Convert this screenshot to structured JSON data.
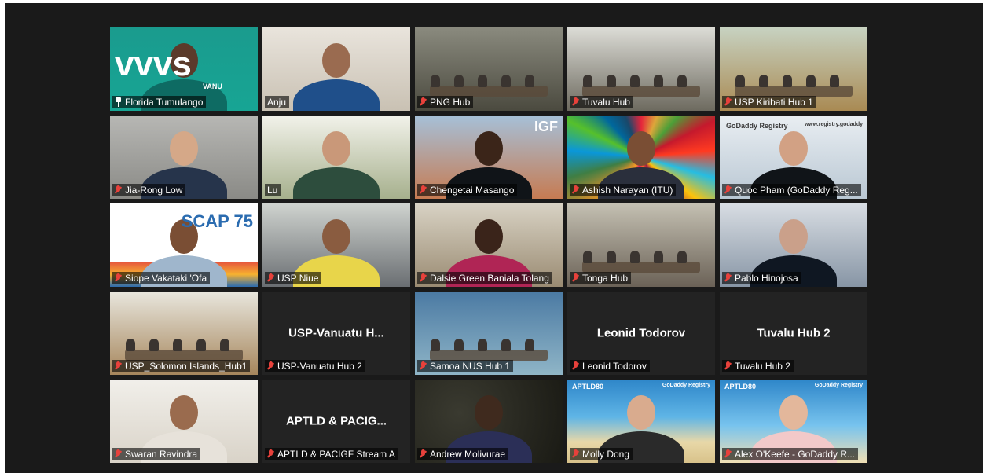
{
  "meeting": {
    "participants": [
      {
        "id": "florida",
        "label": "Florida Tumulango",
        "status": "pinned",
        "display": "video"
      },
      {
        "id": "anju",
        "label": "Anju",
        "status": "none",
        "display": "video"
      },
      {
        "id": "png",
        "label": "PNG Hub",
        "status": "muted",
        "display": "video"
      },
      {
        "id": "tuvalu1",
        "label": "Tuvalu Hub",
        "status": "muted",
        "display": "video"
      },
      {
        "id": "kiribati",
        "label": "USP Kiribati Hub 1",
        "status": "muted",
        "display": "video"
      },
      {
        "id": "jia",
        "label": "Jia-Rong Low",
        "status": "muted",
        "display": "video"
      },
      {
        "id": "lu",
        "label": "Lu",
        "status": "none",
        "display": "video"
      },
      {
        "id": "chengetai",
        "label": "Chengetai Masango",
        "status": "muted",
        "display": "video"
      },
      {
        "id": "ashish",
        "label": "Ashish Narayan (ITU)",
        "status": "muted",
        "display": "video"
      },
      {
        "id": "quoc",
        "label": "Quoc Pham (GoDaddy Reg...",
        "status": "muted",
        "display": "video"
      },
      {
        "id": "siope",
        "label": "Siope Vakataki 'Ofa",
        "status": "muted",
        "display": "video"
      },
      {
        "id": "niue",
        "label": "USP Niue",
        "status": "muted",
        "display": "video"
      },
      {
        "id": "dalsie",
        "label": "Dalsie Green Baniala Tolang",
        "status": "muted",
        "display": "video"
      },
      {
        "id": "tonga",
        "label": "Tonga Hub",
        "status": "muted",
        "display": "video"
      },
      {
        "id": "pablo",
        "label": "Pablo Hinojosa",
        "status": "muted",
        "display": "video"
      },
      {
        "id": "solomon",
        "label": "USP_Solomon Islands_Hub1",
        "status": "muted",
        "display": "video"
      },
      {
        "id": "vanuatu",
        "label": "USP-Vanuatu Hub 2",
        "status": "muted",
        "display": "name",
        "name_display": "USP-Vanuatu  H..."
      },
      {
        "id": "samoa",
        "label": "Samoa NUS Hub 1",
        "status": "muted",
        "display": "video"
      },
      {
        "id": "leonid",
        "label": "Leonid Todorov",
        "status": "muted",
        "display": "name",
        "name_display": "Leonid Todorov"
      },
      {
        "id": "tuvalu2",
        "label": "Tuvalu Hub 2",
        "status": "muted",
        "display": "name",
        "name_display": "Tuvalu Hub 2"
      },
      {
        "id": "swaran",
        "label": "Swaran Ravindra",
        "status": "muted",
        "display": "video"
      },
      {
        "id": "aptld",
        "label": "APTLD & PACIGF Stream A",
        "status": "muted",
        "display": "name",
        "name_display": "APTLD & PACIG..."
      },
      {
        "id": "andrew",
        "label": "Andrew Molivurae",
        "status": "muted",
        "display": "video"
      },
      {
        "id": "molly",
        "label": "Molly Dong",
        "status": "muted",
        "display": "video"
      },
      {
        "id": "alex",
        "label": "Alex O'Keefe - GoDaddy R...",
        "status": "muted",
        "display": "video"
      }
    ]
  },
  "backgrounds": {
    "florida": "vvvs",
    "florida_sub": "VANU",
    "chengetai": "IGF",
    "quoc": "GoDaddy Registry",
    "quoc_url": "www.registry.godaddy",
    "siope": "SCAP 75",
    "molly": "APTLD80",
    "alex": "APTLD80",
    "molly_logo": "GoDaddy Registry",
    "alex_logo": "GoDaddy Registry"
  },
  "colors": {
    "active_speaker_border": "#d6d97a",
    "muted_icon": "#e8413b",
    "tile_bg": "#232323"
  }
}
